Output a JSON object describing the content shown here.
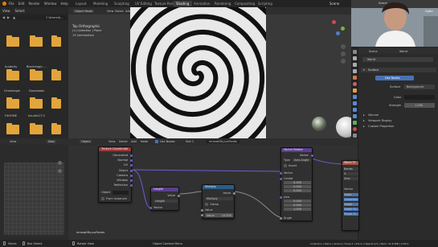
{
  "menu": {
    "items": [
      "File",
      "Edit",
      "Render",
      "Window",
      "Help"
    ],
    "workspaces": [
      "Layout",
      "Modeling",
      "Sculpting",
      "UV Editing",
      "Texture Paint",
      "Shading",
      "Animation",
      "Rendering",
      "Compositing",
      "Scripting"
    ],
    "active_workspace": "Shading",
    "scene": "Scene",
    "options": "Optio"
  },
  "filebrowser": {
    "header": [
      "View",
      "Select"
    ],
    "path": "C:\\Users\\&...",
    "folders": [
      "Audacity",
      "Blackmagic ...",
      "",
      "",
      "Cinestragm",
      "Downloads",
      "",
      "",
      "FXHOME",
      "houdini17.5",
      "",
      ""
    ]
  },
  "viewport": {
    "mode": "Object Mode",
    "menus": [
      "View",
      "Select",
      "Add",
      "Object"
    ],
    "overlay_title": "Top Orthographic",
    "overlay_collection": "(1) Collection | Plane",
    "overlay_info": "13 Centimeters"
  },
  "properties": {
    "scene_tab": "Scene",
    "world_tab": "World",
    "world_name": "World",
    "sections": {
      "surface": "Surface",
      "volume": "Volume",
      "viewport_display": "Viewport Display",
      "custom_props": "Custom Properties"
    },
    "surface_label": "Surface",
    "surface_value": "Background",
    "color_label": "Color",
    "strength_label": "Strength",
    "strength_value": "1.000",
    "use_nodes": "Use Nodes"
  },
  "node_editor": {
    "header": [
      "Object",
      "View",
      "Select",
      "Add",
      "Node"
    ],
    "use_nodes": "Use Nodes",
    "slot": "Slot 1",
    "material": "mrsswitfty.surflends",
    "bottom_label": "mrsswitfty.surflends",
    "tex_coord": {
      "title": "Texture Coordinate",
      "outputs": [
        "Generated",
        "Normal",
        "UV",
        "Object",
        "Camera",
        "Window",
        "Reflection"
      ],
      "object_label": "Object",
      "from_instancer": "From Instancer"
    },
    "length": {
      "title": "Length",
      "output": "Value",
      "op": "Length",
      "input": "Vector"
    },
    "multiply": {
      "title": "Multiply",
      "output": "Value",
      "op": "Multiply",
      "clamp": "Clamp",
      "input": "Value",
      "value_label": "Value",
      "value": "10.000"
    },
    "vector_rotate": {
      "title": "Vector Rotate",
      "output": "Vector",
      "type_label": "Type",
      "type_value": "Axis Angle",
      "invert": "Invert",
      "vector": "Vector",
      "center": "Center",
      "center_values": [
        "0.000",
        "0.000",
        "0.000"
      ],
      "axis": "Axis",
      "axis_values": [
        "0.000",
        "0.000",
        "1.000"
      ],
      "angle": "Angle"
    },
    "wave": {
      "title": "Wave Te",
      "items": [
        "Bands",
        "X",
        "Sine",
        "",
        "Vector",
        "Scale",
        "Distortion",
        "Detail",
        "Detail Sc...",
        "Phase O..."
      ]
    }
  },
  "side_panel": {
    "view": "View",
    "new": "New"
  },
  "status": {
    "select": "Select",
    "box_select": "Box Select",
    "rotate": "Rotate View",
    "context": "Object Context Menu",
    "stats": "Collection | Plane | Verts:4 | Faces:1 | Tris:2 | Objects:1/1 | Mem: 31.6 MiB | 2.83.0"
  },
  "colors": {
    "tex_coord_header": "#9b3a3a",
    "vector_header": "#5a3f8e",
    "converter_header": "#2a5d88",
    "texture_header": "#a4513d",
    "socket_yellow": "#d3b43a",
    "socket_purple": "#6e5cd0",
    "socket_grey": "#8d8d8d",
    "accent_blue": "#4772b3"
  }
}
